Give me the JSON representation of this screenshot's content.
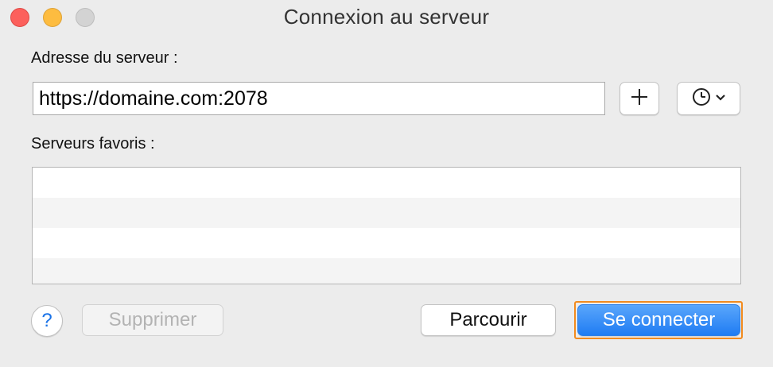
{
  "window": {
    "title": "Connexion au serveur"
  },
  "address": {
    "label": "Adresse du serveur :",
    "value": "https://domaine.com:2078",
    "add_icon": "plus-icon",
    "recent_icon": "clock-icon"
  },
  "favorites": {
    "label": "Serveurs favoris :",
    "items": []
  },
  "footer": {
    "help_label": "?",
    "delete_label": "Supprimer",
    "browse_label": "Parcourir",
    "connect_label": "Se connecter"
  },
  "colors": {
    "accent": "#1f7cf3",
    "focus": "#f28b1e",
    "close": "#fc605c",
    "minimize": "#fdbc40",
    "zoom_disabled": "#d3d3d3"
  }
}
